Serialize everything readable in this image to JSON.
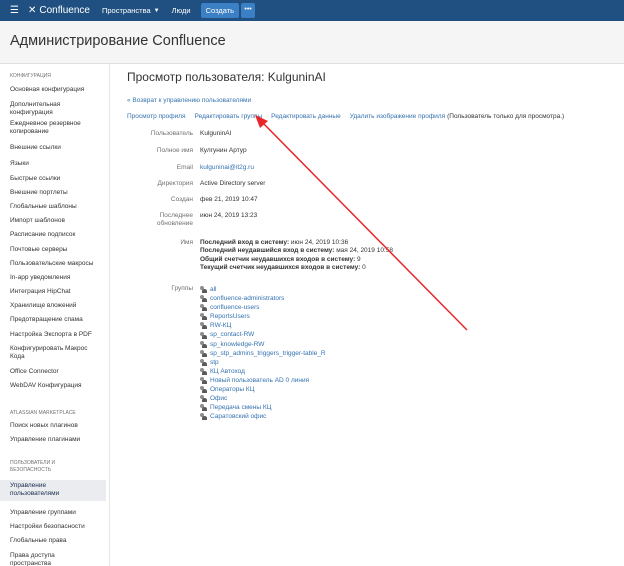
{
  "topbar": {
    "logo": "Confluence",
    "nav_spaces": "Пространства",
    "nav_people": "Люди",
    "create": "Создать",
    "more": "•••"
  },
  "admin_header": {
    "title": "Администрирование Confluence"
  },
  "sidebar": {
    "sections": [
      {
        "title": "КОНФИГУРАЦИЯ",
        "items": [
          "Основная конфигурация",
          "Дополнительная конфигурация",
          "Ежедневное резервное копирование",
          "Внешние ссылки",
          "Языки",
          "Быстрые ссылки",
          "Внешние портлеты",
          "Глобальные шаблоны",
          "Импорт шаблонов",
          "Расписание подписок",
          "Почтовые серверы",
          "Пользовательские макросы",
          "In-app уведомления",
          "Интеграция HipChat",
          "Хранилище вложений",
          "Предотвращение спама",
          "Настройка Экспорта в PDF",
          "Конфигурировать Макрос Кода",
          "Office Connector",
          "WebDAV Конфигурация"
        ]
      },
      {
        "title": "ATLASSIAN MARKETPLACE",
        "items": [
          "Поиск новых плагинов",
          "Управление плагинами"
        ]
      },
      {
        "title": "ПОЛЬЗОВАТЕЛИ И БЕЗОПАСНОСТЬ",
        "items": [
          "Управление пользователями",
          "Управление группами",
          "Настройки безопасности",
          "Глобальные права",
          "Права доступа пространства"
        ]
      }
    ],
    "active": "Управление пользователями"
  },
  "main": {
    "title": "Просмотр пользователя: KulguninAI",
    "back_link": "« Возврат к управлению пользователями",
    "tabs": [
      "Просмотр профиля",
      "Редактировать группы",
      "Редактировать данные",
      "Удалить изображение профиля"
    ],
    "tabs_note": "(Пользователь только для просмотра.)",
    "fields": [
      {
        "label": "Пользователь",
        "value": "KulguninAI"
      },
      {
        "label": "Полное имя",
        "value": "Кулгунин Артур"
      },
      {
        "label": "Email",
        "value": "kulguninai@it2g.ru"
      },
      {
        "label": "Директория",
        "value": "Active Directory server"
      },
      {
        "label": "Создан",
        "value": "фев 21, 2019 10:47"
      },
      {
        "label": "Последнее обновление",
        "value": "июн 24, 2019 13:23"
      }
    ],
    "name_label": "Имя",
    "stats": [
      {
        "label": "Последний вход в систему:",
        "value": "июн 24, 2019 10:36"
      },
      {
        "label": "Последний неудавшийся вход в систему:",
        "value": "мая 24, 2019 10:58"
      },
      {
        "label": "Общий счетчик неудавшихся входов в систему:",
        "value": "9"
      },
      {
        "label": "Текущий счетчик неудавшихся входов в систему:",
        "value": "0"
      }
    ],
    "groups_label": "Группы",
    "groups": [
      "all",
      "confluence-administrators",
      "confluence-users",
      "ReportsUsers",
      "RW-КЦ",
      "sp_contact-RW",
      "sp_knowledge-RW",
      "sp_stp_admins_triggers_trigger-table_R",
      "stp",
      "КЦ Автоход",
      "Новый пользователь AD 0 линия",
      "Операторы КЦ",
      "Офис",
      "Передача смены КЦ",
      "Саратовский офис"
    ]
  },
  "colors": {
    "header": "#205081",
    "link": "#3572b0",
    "annotation_arrow": "#e8262a"
  }
}
